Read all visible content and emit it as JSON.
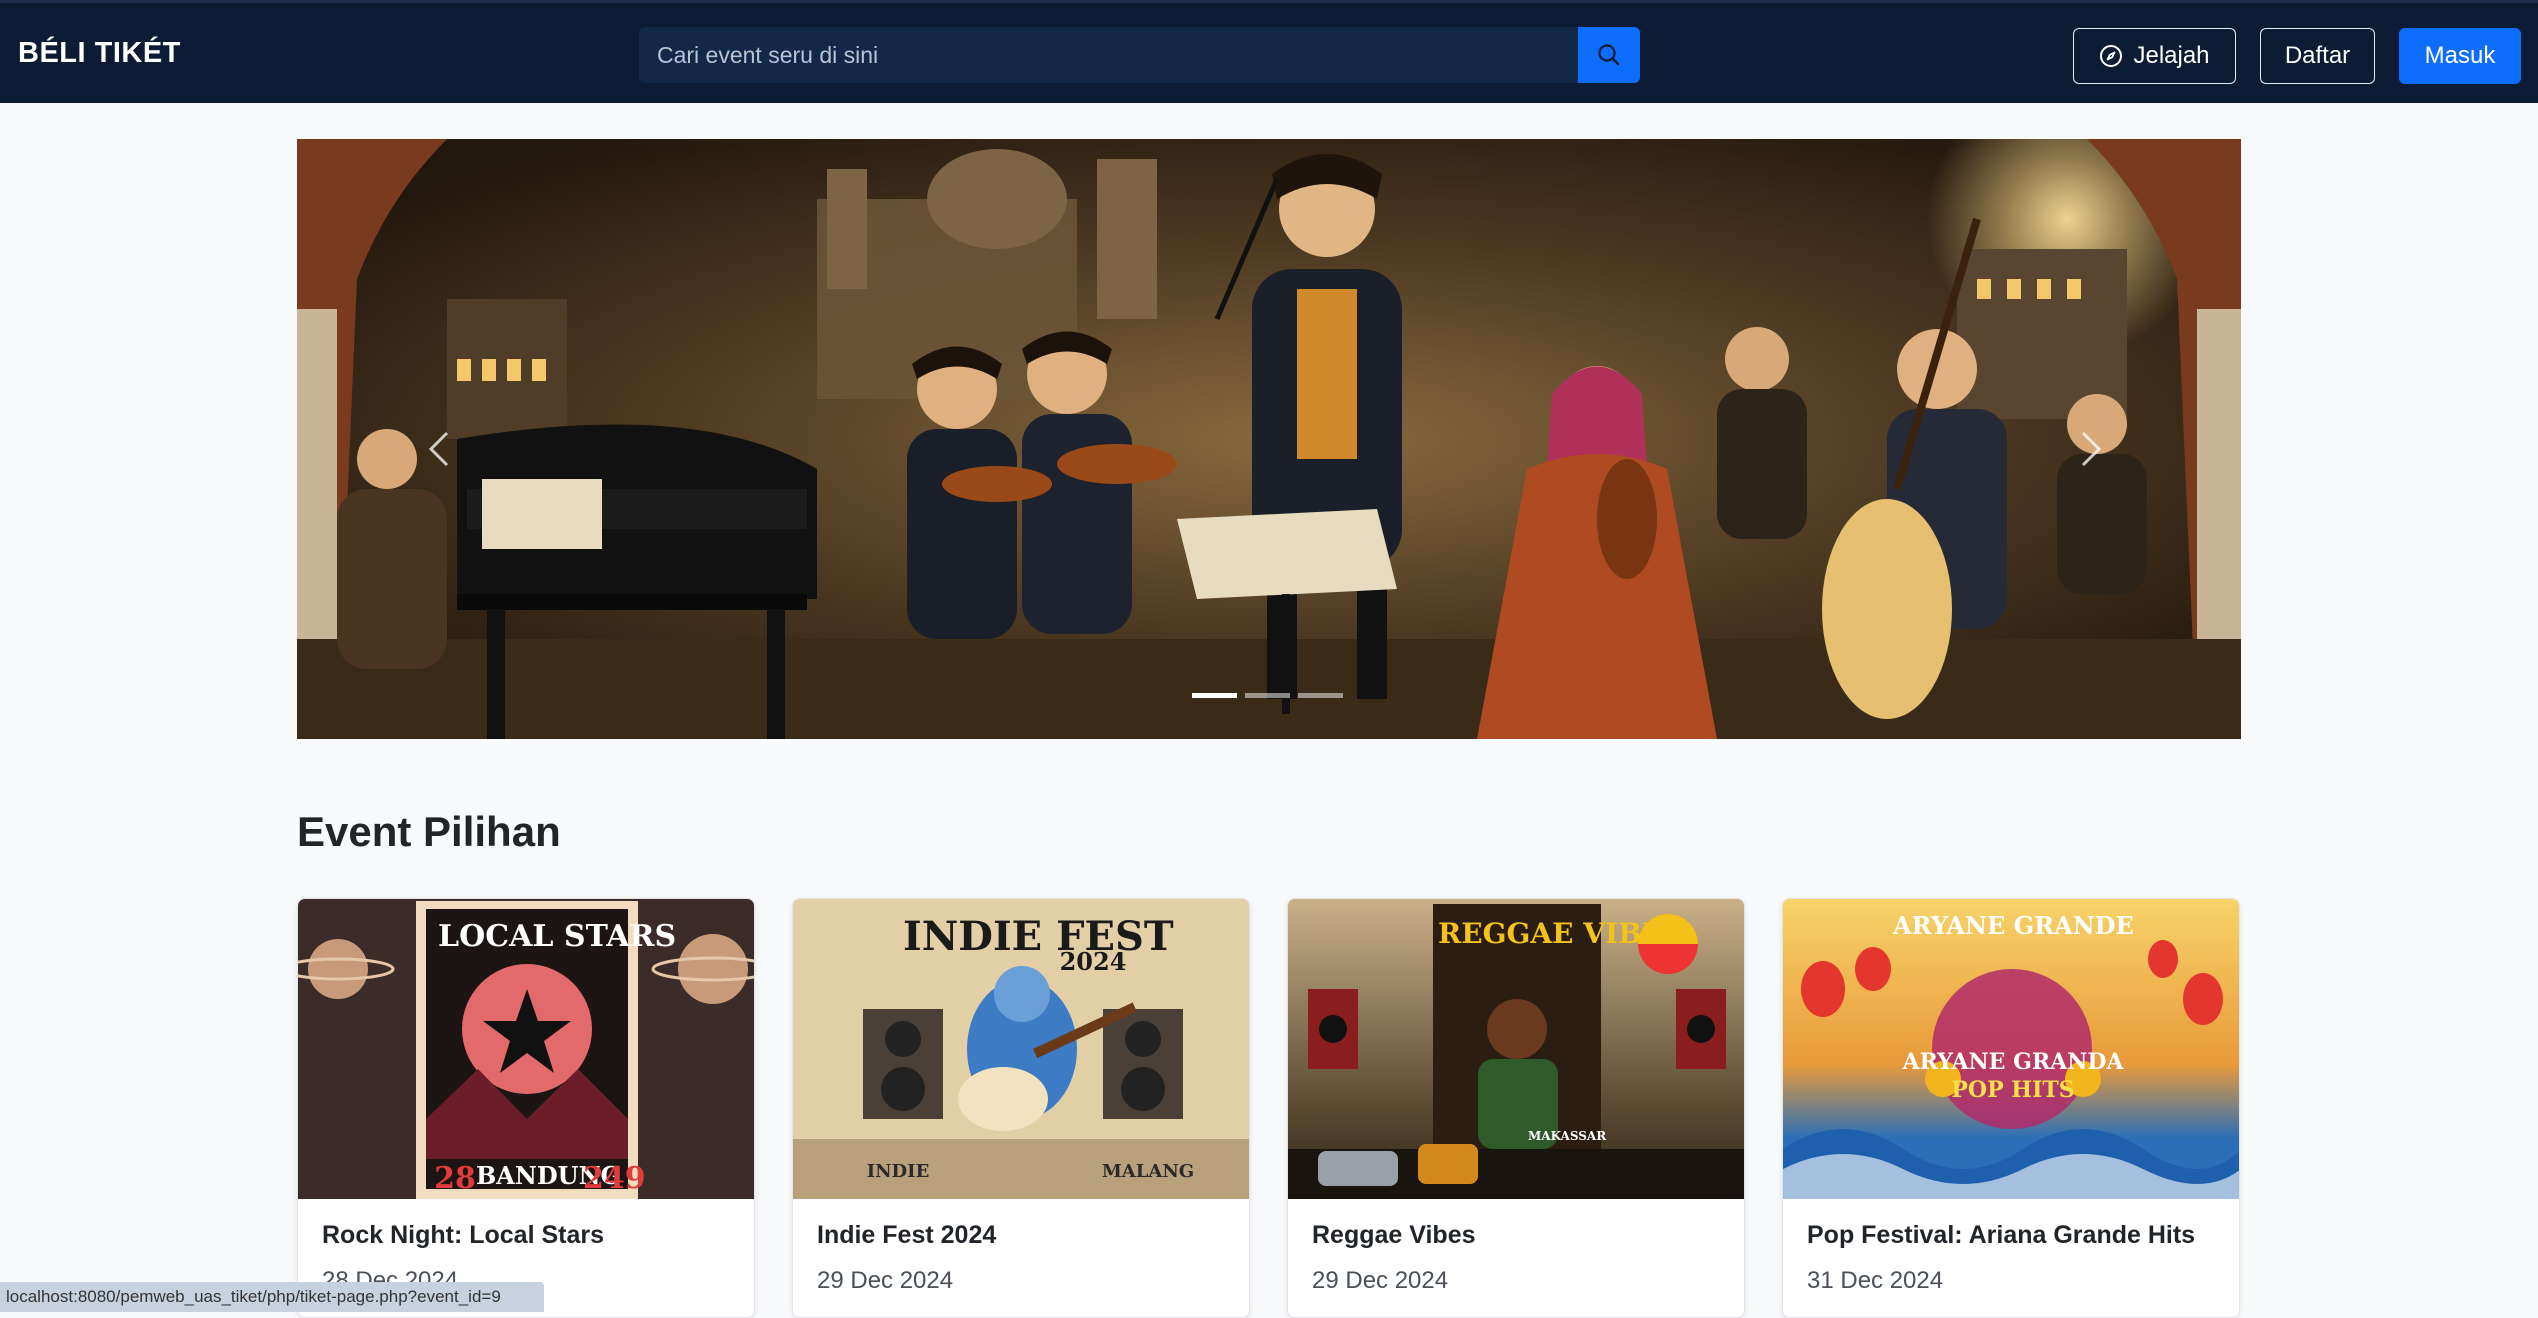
{
  "navbar": {
    "brand": "BÉLI TIKÉT",
    "search_placeholder": "Cari event seru di sini",
    "search_icon": "search-icon",
    "explore_label": "Jelajah",
    "explore_icon": "compass-icon",
    "register_label": "Daftar",
    "login_label": "Masuk"
  },
  "carousel": {
    "slide_count": 3,
    "active_index": 0,
    "prev_icon": "chevron-left-icon",
    "next_icon": "chevron-right-icon"
  },
  "section": {
    "title": "Event Pilihan"
  },
  "events": [
    {
      "title": "Rock Night: Local Stars",
      "date": "28 Dec 2024",
      "poster_lines": [
        "LOCAL STARS",
        "28",
        "BANDUNG",
        "249"
      ]
    },
    {
      "title": "Indie Fest 2024",
      "date": "29 Dec 2024",
      "poster_lines": [
        "INDIE FEST",
        "2024",
        "INDIE",
        "MALANG"
      ]
    },
    {
      "title": "Reggae Vibes",
      "date": "29 Dec 2024",
      "poster_lines": [
        "REGGAE VIBES",
        "MAKASSAR"
      ]
    },
    {
      "title": "Pop Festival: Ariana Grande Hits",
      "date": "31 Dec 2024",
      "poster_lines": [
        "ARYANE GRANDE",
        "ARYANE GRANDA",
        "POP HITS"
      ]
    }
  ],
  "status_bar": {
    "url": "localhost:8080/pemweb_uas_tiket/php/tiket-page.php?event_id=9"
  },
  "colors": {
    "navbar_bg": "#0d1b34",
    "primary": "#0d6efd",
    "page_bg": "#f8f9fa"
  }
}
